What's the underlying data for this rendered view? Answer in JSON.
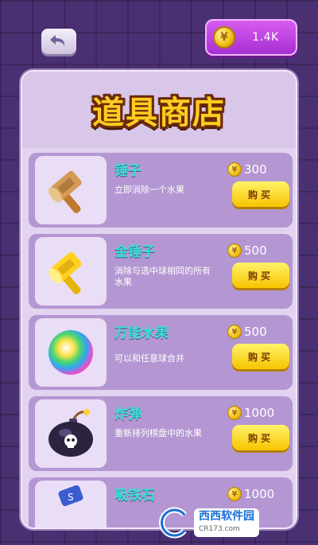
{
  "top_bar": {
    "back_icon": "back-arrow-icon",
    "coin_symbol": "¥",
    "coin_balance": "1.4K"
  },
  "shop": {
    "title": "道具商店",
    "buy_label": "购买",
    "items": [
      {
        "name": "锤子",
        "description": "立即消除一个水果",
        "price": "300",
        "icon": "hammer-icon"
      },
      {
        "name": "金锤子",
        "description": "消除与选中球相同的所有水果",
        "price": "500",
        "icon": "gold-hammer-icon"
      },
      {
        "name": "万能水果",
        "description": "可以和任意球合并",
        "price": "500",
        "icon": "rainbow-fruit-icon"
      },
      {
        "name": "炸弹",
        "description": "重新排列棋盘中的水果",
        "price": "1000",
        "icon": "bomb-icon"
      },
      {
        "name": "吸铁石",
        "description": "",
        "price": "1000",
        "icon": "magnet-icon"
      }
    ]
  },
  "watermark": {
    "brand": "西西软件园",
    "url": "CR173.com"
  }
}
